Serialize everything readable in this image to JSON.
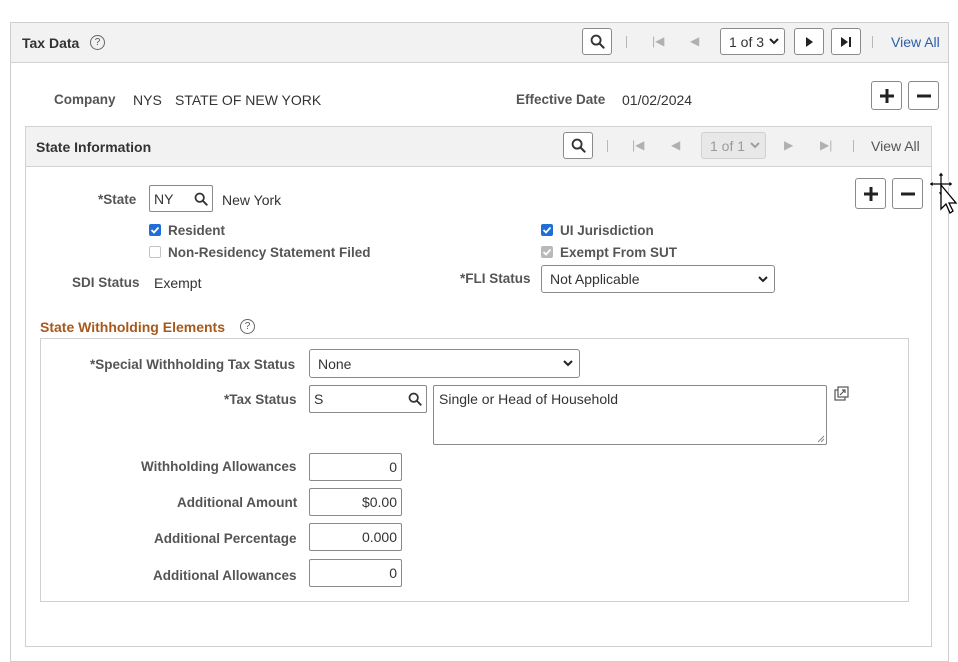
{
  "page": {
    "title": "Tax Data",
    "help_glyph": "?",
    "pager": {
      "value": "1 of 3",
      "view_all": "View All"
    }
  },
  "company": {
    "label": "Company",
    "code": "NYS",
    "name": "STATE OF NEW YORK",
    "effective_date_label": "Effective Date",
    "effective_date": "01/02/2024"
  },
  "state_info": {
    "title": "State Information",
    "pager": {
      "value": "1 of 1",
      "view_all": "View All"
    },
    "state_label": "*State",
    "state_code": "NY",
    "state_name": "New York",
    "resident_label": "Resident",
    "resident_checked": true,
    "non_residency_label": "Non-Residency Statement Filed",
    "non_residency_checked": false,
    "ui_jurisdiction_label": "UI Jurisdiction",
    "ui_jurisdiction_checked": true,
    "exempt_sut_label": "Exempt From SUT",
    "exempt_sut_checked": true,
    "sdi_status_label": "SDI Status",
    "sdi_status": "Exempt",
    "fli_status_label": "*FLI Status",
    "fli_status": "Not Applicable"
  },
  "withholding": {
    "title": "State Withholding Elements",
    "special_label": "*Special Withholding Tax Status",
    "special_value": "None",
    "tax_status_label": "*Tax Status",
    "tax_status_code": "S",
    "tax_status_desc": "Single or Head of Household",
    "withholding_allowances_label": "Withholding Allowances",
    "withholding_allowances": "0",
    "additional_amount_label": "Additional Amount",
    "additional_amount": "$0.00",
    "additional_percentage_label": "Additional Percentage",
    "additional_percentage": "0.000",
    "additional_allowances_label": "Additional Allowances",
    "additional_allowances": "0"
  },
  "colors": {
    "accent_link": "#2c5fa8",
    "section_title": "#a8581a",
    "checkbox_on": "#1f6fd6"
  }
}
